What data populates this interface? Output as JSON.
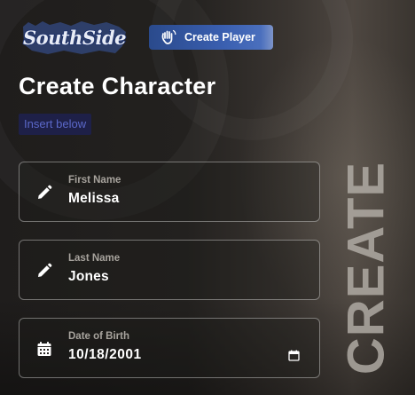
{
  "brand": {
    "logo_text": "SouthSide"
  },
  "header": {
    "create_player_label": "Create Player",
    "create_player_icon": "hand-wave-icon",
    "button_color": "#3a5fb0"
  },
  "page": {
    "title": "Create Character",
    "subtitle": "Insert below",
    "side_word": "CREATE"
  },
  "form": {
    "fields": [
      {
        "label": "First Name",
        "value": "Melissa",
        "icon": "pencil-icon"
      },
      {
        "label": "Last Name",
        "value": "Jones",
        "icon": "pencil-icon"
      },
      {
        "label": "Date of Birth",
        "value": "10/18/2001",
        "icon": "calendar-icon",
        "trailing_icon": "calendar-picker-icon"
      }
    ]
  },
  "colors": {
    "accent_blue": "#3a5fb0",
    "chip_bg": "#1e2048",
    "chip_text": "#5b68c9",
    "text_primary": "#ffffff",
    "text_muted": "#a7a39d"
  }
}
